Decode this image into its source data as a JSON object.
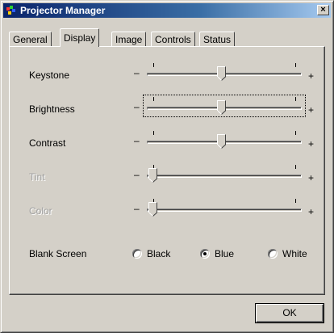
{
  "window": {
    "title": "Projector Manager",
    "close_label": "×",
    "titlebar_color": "#0a246a"
  },
  "tabs": [
    {
      "label": "General",
      "active": false
    },
    {
      "label": "Display",
      "active": true
    },
    {
      "label": "Image",
      "active": false
    },
    {
      "label": "Controls",
      "active": false
    },
    {
      "label": "Status",
      "active": false
    }
  ],
  "sliders": [
    {
      "label": "Keystone",
      "enabled": true,
      "focused": false,
      "value_fraction": 0.48
    },
    {
      "label": "Brightness",
      "enabled": true,
      "focused": true,
      "value_fraction": 0.48
    },
    {
      "label": "Contrast",
      "enabled": true,
      "focused": false,
      "value_fraction": 0.48
    },
    {
      "label": "Tint",
      "enabled": false,
      "focused": false,
      "value_fraction": 0.0
    },
    {
      "label": "Color",
      "enabled": false,
      "focused": false,
      "value_fraction": 0.0
    }
  ],
  "slider_minus": "–",
  "slider_plus": "+",
  "blank_screen": {
    "label": "Blank Screen",
    "options": [
      {
        "label": "Black",
        "selected": false
      },
      {
        "label": "Blue",
        "selected": true
      },
      {
        "label": "White",
        "selected": false
      }
    ]
  },
  "ok_button": {
    "label": "OK"
  }
}
